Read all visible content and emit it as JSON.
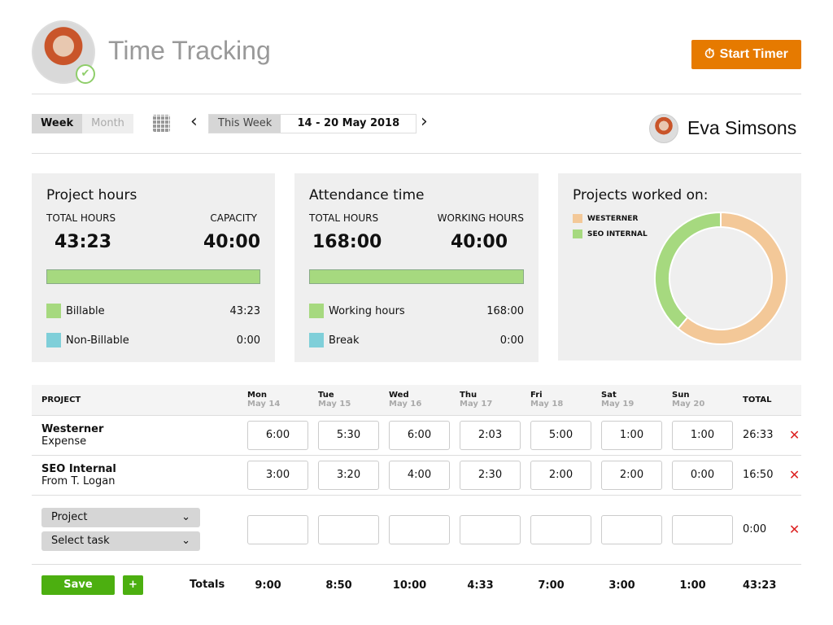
{
  "header": {
    "title": "Time Tracking",
    "start_timer": "Start Timer",
    "icon": "stopwatch-icon"
  },
  "toolbar": {
    "week": "Week",
    "month": "Month",
    "this_week": "This Week",
    "date_range": "14 - 20 May 2018",
    "prev": "‹",
    "next": "›"
  },
  "user": {
    "name": "Eva Simsons"
  },
  "project_hours": {
    "title": "Project hours",
    "total_label": "TOTAL HOURS",
    "capacity_label": "CAPACITY",
    "total": "43:23",
    "capacity": "40:00",
    "progress_percent": 100,
    "legend": [
      {
        "label": "Billable",
        "value": "43:23",
        "color": "#a6d97f"
      },
      {
        "label": "Non-Billable",
        "value": "0:00",
        "color": "#7fcfd9"
      }
    ]
  },
  "attendance": {
    "title": "Attendance time",
    "total_label": "TOTAL HOURS",
    "working_label": "WORKING HOURS",
    "total": "168:00",
    "working": "40:00",
    "progress_percent": 100,
    "legend": [
      {
        "label": "Working hours",
        "value": "168:00",
        "color": "#a6d97f"
      },
      {
        "label": "Break",
        "value": "0:00",
        "color": "#7fcfd9"
      }
    ]
  },
  "chart_data": {
    "type": "pie",
    "title": "Projects worked on:",
    "donut": true,
    "series": [
      {
        "name": "WESTERNER",
        "value": 26.55,
        "color": "#f3c898"
      },
      {
        "name": "SEO INTERNAL",
        "value": 16.83,
        "color": "#a6d97f"
      }
    ]
  },
  "table": {
    "project_header": "PROJECT",
    "total_header": "TOTAL",
    "days": [
      {
        "day": "Mon",
        "date": "May 14"
      },
      {
        "day": "Tue",
        "date": "May 15"
      },
      {
        "day": "Wed",
        "date": "May 16"
      },
      {
        "day": "Thu",
        "date": "May 17"
      },
      {
        "day": "Fri",
        "date": "May 18"
      },
      {
        "day": "Sat",
        "date": "May 19"
      },
      {
        "day": "Sun",
        "date": "May 20"
      }
    ],
    "rows": [
      {
        "project": "Westerner",
        "task": "Expense",
        "hours": [
          "6:00",
          "5:30",
          "6:00",
          "2:03",
          "5:00",
          "1:00",
          "1:00"
        ],
        "total": "26:33"
      },
      {
        "project": "SEO Internal",
        "task": "From T. Logan",
        "hours": [
          "3:00",
          "3:20",
          "4:00",
          "2:30",
          "2:00",
          "2:00",
          "0:00"
        ],
        "total": "16:50"
      }
    ],
    "new_row": {
      "project_placeholder": "Project",
      "task_placeholder": "Select task",
      "total": "0:00"
    },
    "totals_label": "Totals",
    "totals": [
      "9:00",
      "8:50",
      "10:00",
      "4:33",
      "7:00",
      "3:00",
      "1:00"
    ],
    "grand_total": "43:23",
    "save": "Save",
    "add": "+",
    "delete": "✕"
  }
}
